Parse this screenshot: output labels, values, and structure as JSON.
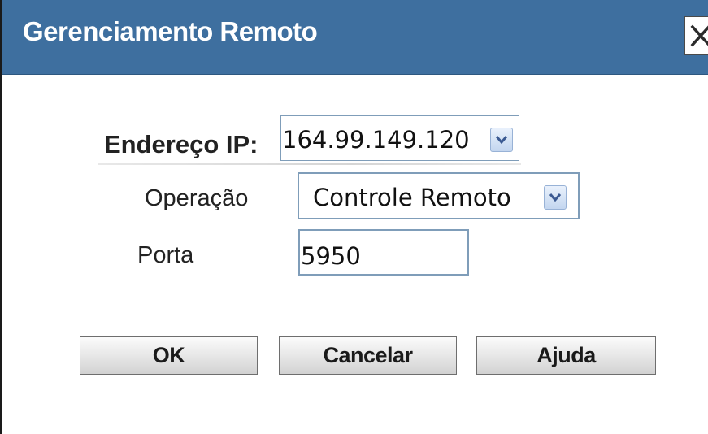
{
  "dialog": {
    "title": "Gerenciamento Remoto",
    "close_icon": "close-x-icon"
  },
  "form": {
    "ip_label": "Endereço IP:",
    "ip_value": "164.99.149.120",
    "operation_label": "Operação",
    "operation_value": "Controle Remoto",
    "port_label": "Porta",
    "port_value": "5950",
    "dropdown_icon": "chevron-down-icon"
  },
  "buttons": {
    "ok": "OK",
    "cancel": "Cancelar",
    "help": "Ajuda"
  },
  "colors": {
    "titlebar": "#3e6f9f",
    "field_border": "#7f9db9"
  }
}
